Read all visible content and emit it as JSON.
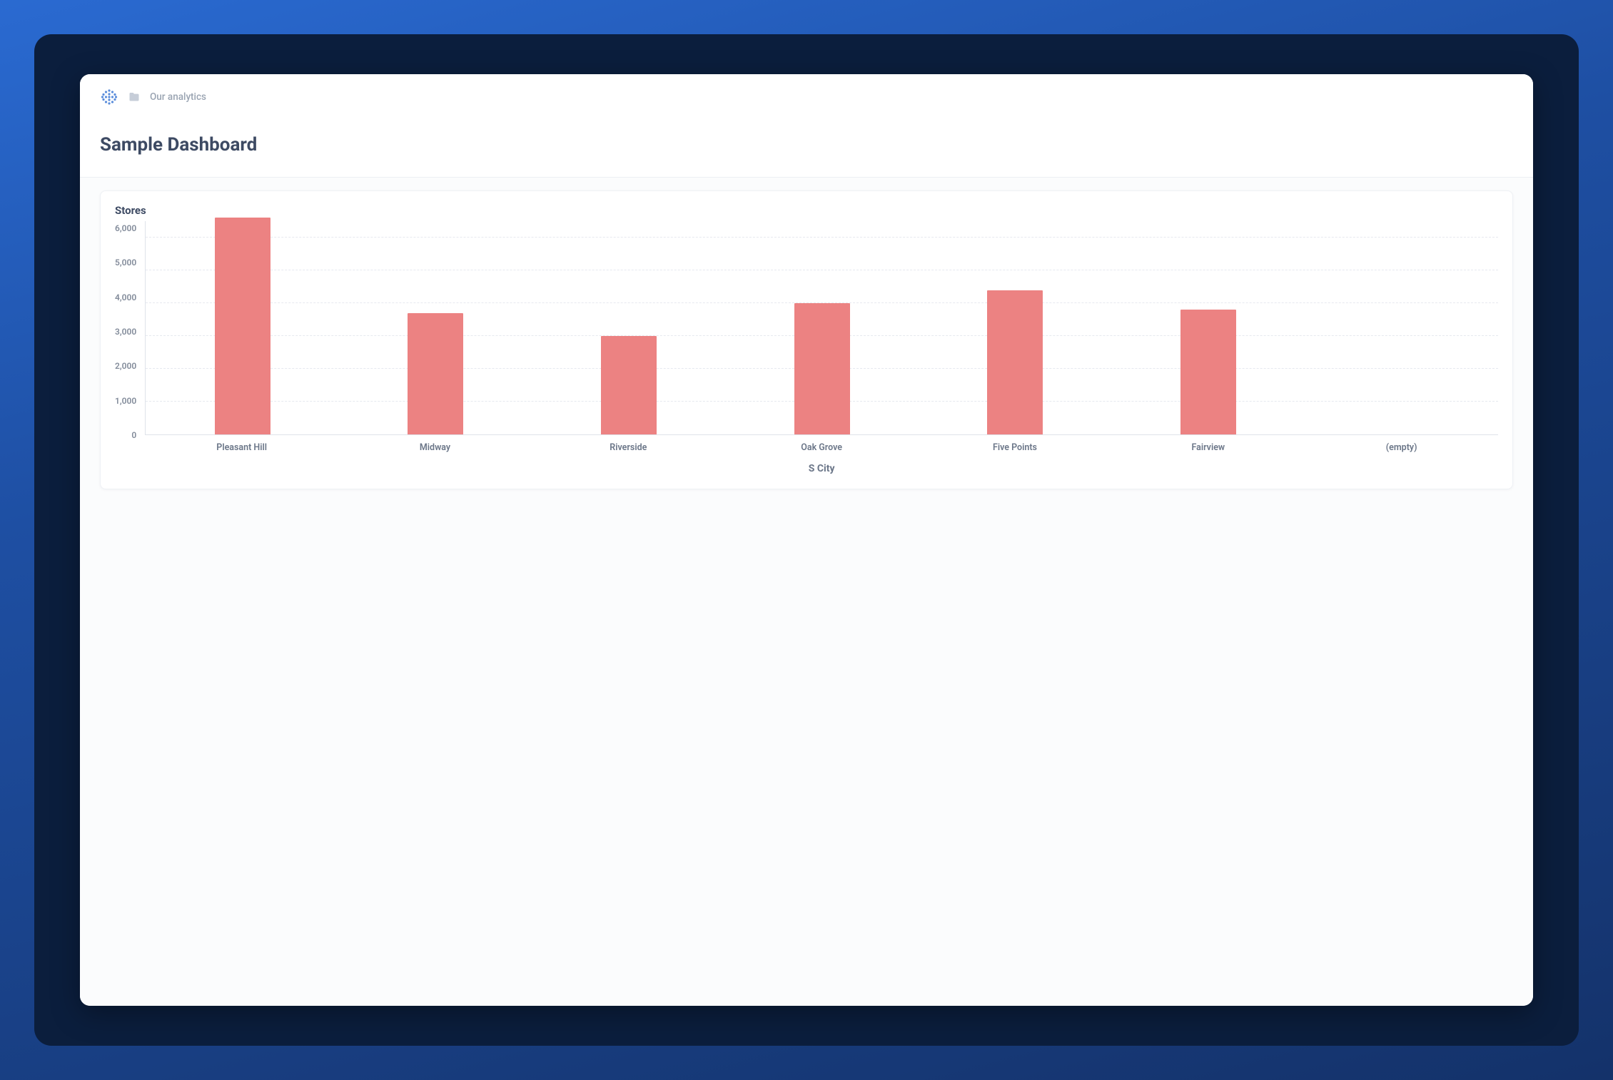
{
  "breadcrumb": {
    "folder_label": "Our analytics"
  },
  "page": {
    "title": "Sample Dashboard"
  },
  "chart": {
    "title": "Stores"
  },
  "chart_data": {
    "type": "bar",
    "title": "Stores",
    "xlabel": "S City",
    "ylabel": "",
    "ylim": [
      0,
      6500
    ],
    "y_ticks": [
      6000,
      5000,
      4000,
      3000,
      2000,
      1000,
      0
    ],
    "y_tick_labels": [
      "6,000",
      "5,000",
      "4,000",
      "3,000",
      "2,000",
      "1,000",
      "0"
    ],
    "categories": [
      "Pleasant Hill",
      "Midway",
      "Riverside",
      "Oak Grove",
      "Five Points",
      "Fairview",
      "(empty)"
    ],
    "values": [
      6600,
      3700,
      3000,
      4000,
      4400,
      3800,
      0
    ],
    "bar_color": "#ec8282"
  }
}
